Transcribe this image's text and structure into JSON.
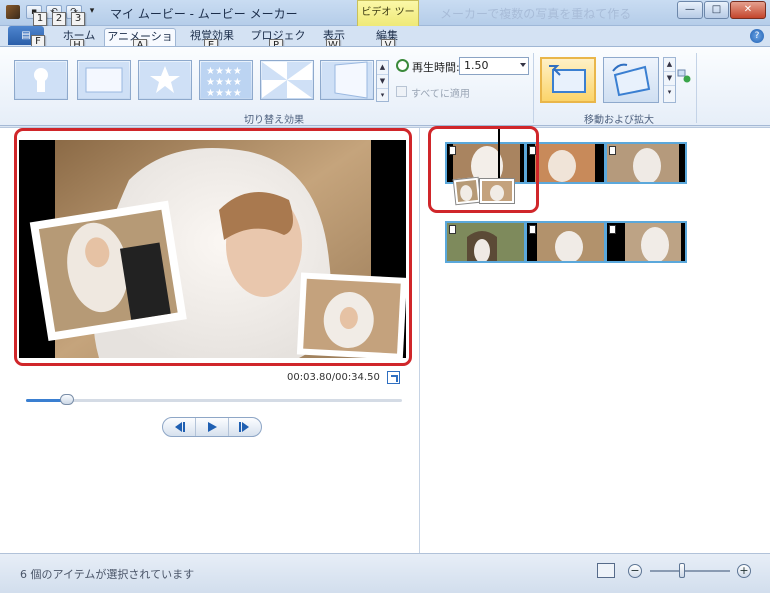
{
  "window": {
    "title": "マイ ムービー - ムービー メーカー",
    "title_faded": "メーカーで複数の写真を重ねて作る",
    "context_tab": "ビデオ ツール",
    "minimize": "—",
    "maximize": "□",
    "close": "✕"
  },
  "quick_access": {
    "keytips": [
      "1",
      "2",
      "3"
    ]
  },
  "tabs": {
    "file": {
      "label": "▤",
      "keytip": "F"
    },
    "items": [
      {
        "label": "ホーム",
        "keytip": "H"
      },
      {
        "label": "アニメーション",
        "keytip": "A"
      },
      {
        "label": "視覚効果",
        "keytip": "E"
      },
      {
        "label": "プロジェクト",
        "keytip": "P"
      },
      {
        "label": "表示",
        "keytip": "W"
      },
      {
        "label": "編集",
        "keytip": "V"
      }
    ],
    "active": "アニメーション",
    "help": "?"
  },
  "ribbon": {
    "transitions_group_label": "切り替え効果",
    "duration_label": "再生時間:",
    "duration_value": "1.50",
    "apply_all_label": "すべてに適用",
    "pan_zoom_group_label": "移動および拡大",
    "transition_icons": [
      "keyhole-transition-icon",
      "rectangle-transition-icon",
      "star-transition-icon",
      "stars-grid-transition-icon",
      "pinwheel-transition-icon",
      "page-turn-transition-icon"
    ],
    "pan_zoom_icons": [
      "pan-zoom-in-icon",
      "pan-zoom-rotate-icon"
    ]
  },
  "preview": {
    "time": "00:03.80/00:34.50",
    "progress_fraction": 0.11
  },
  "storyboard": {
    "rows": [
      {
        "clips": 3
      },
      {
        "clips": 3
      }
    ]
  },
  "status": {
    "text": "6 個のアイテムが選択されています",
    "zoom_out": "−",
    "zoom_in": "+",
    "zoom_fraction": 0.4
  },
  "colors": {
    "accent": "#3a7fd1",
    "highlight": "#d0262a",
    "selection": "#e9b64a"
  }
}
